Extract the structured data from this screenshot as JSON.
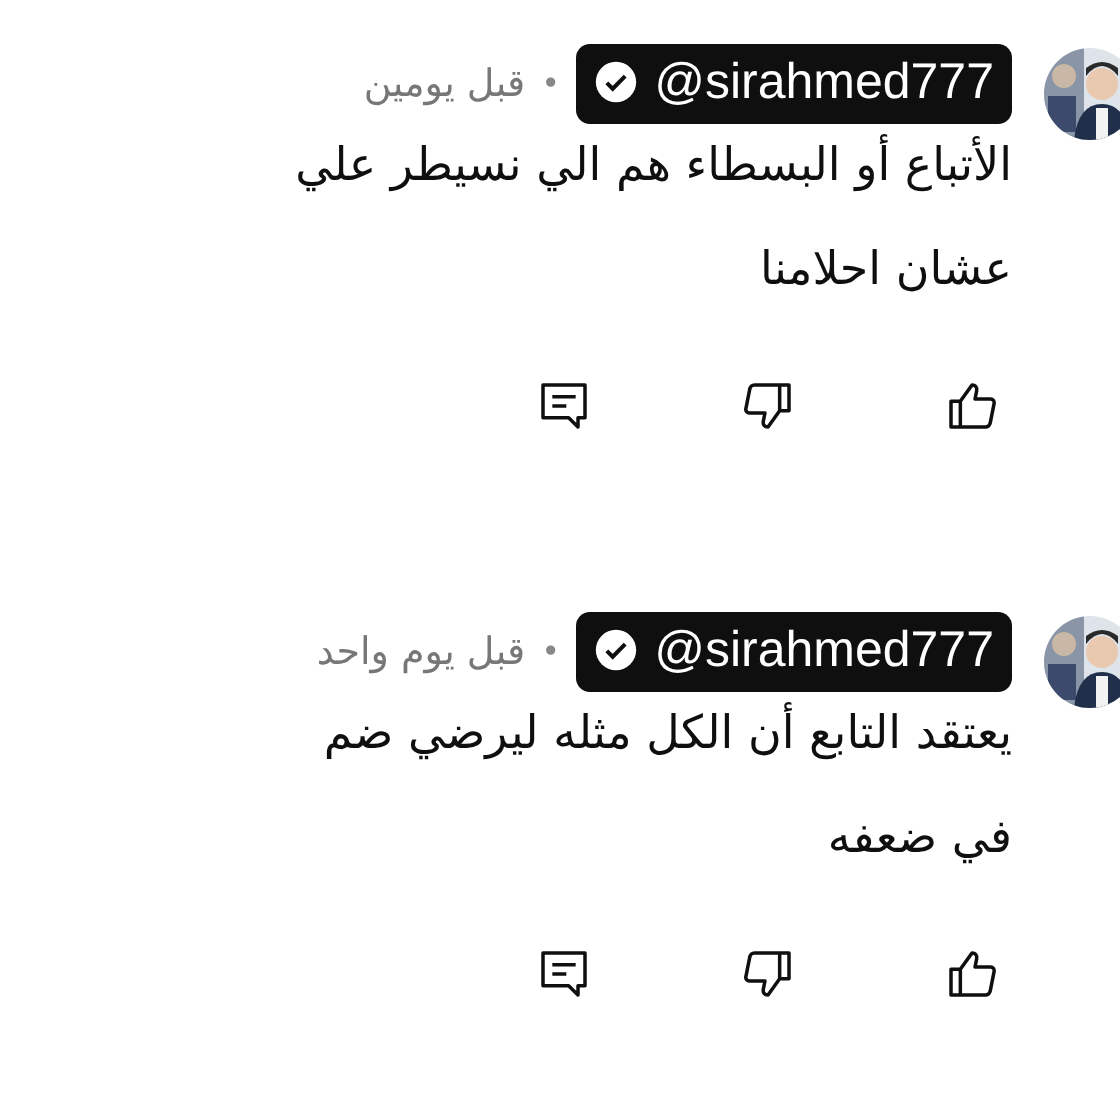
{
  "comments": [
    {
      "author": "@sirahmed777",
      "verified": true,
      "separator": "•",
      "time": "قبل يومين",
      "lines": [
        "الأتباع أو البسطاء هم الي نسيطر علي",
        "عشان احلامنا"
      ]
    },
    {
      "author": "@sirahmed777",
      "verified": true,
      "separator": "•",
      "time": "قبل يوم واحد",
      "lines": [
        "يعتقد التابع أن الكل مثله ليرضي ضم",
        "في ضعفه"
      ]
    }
  ]
}
